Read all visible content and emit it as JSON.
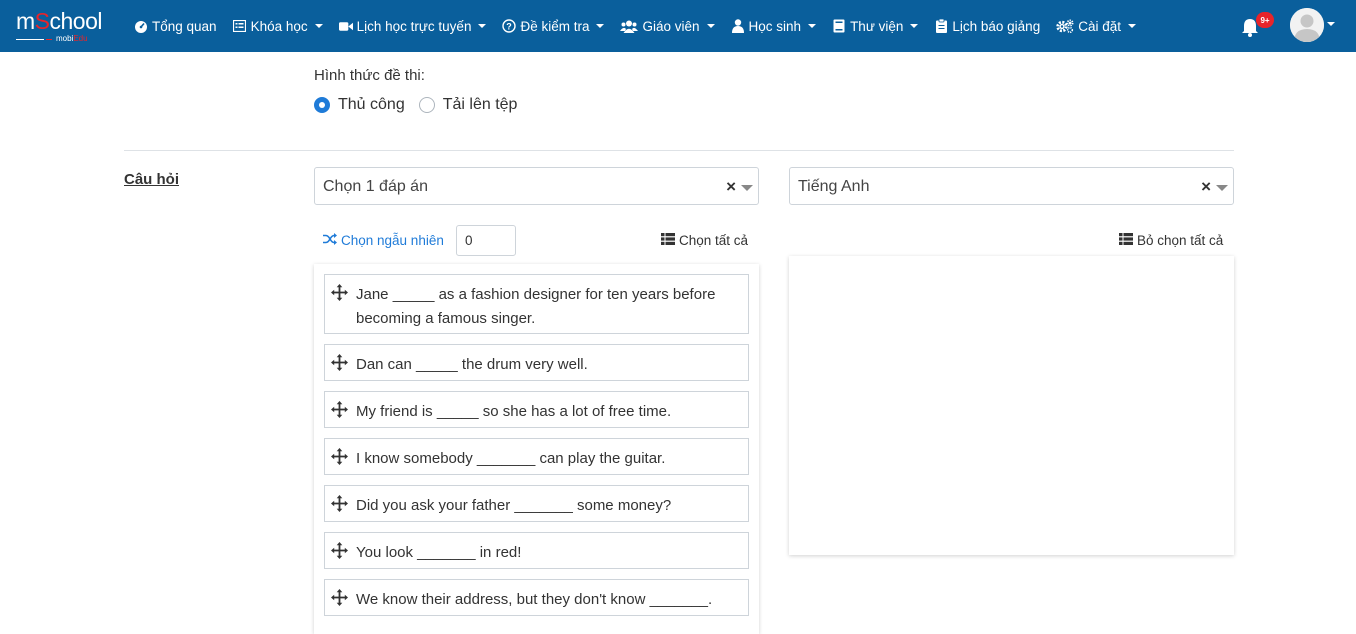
{
  "brand": {
    "logo_main": "m",
    "logo_o": "S",
    "logo_rest": "chool",
    "logo_sub_a": "mobi",
    "logo_sub_b": "Edu"
  },
  "nav": {
    "items": [
      {
        "label": "Tổng quan",
        "icon": "dashboard-icon",
        "dropdown": false
      },
      {
        "label": "Khóa học",
        "icon": "list-icon",
        "dropdown": true
      },
      {
        "label": "Lịch học trực tuyến",
        "icon": "video-icon",
        "dropdown": true
      },
      {
        "label": "Đề kiểm tra",
        "icon": "question-icon",
        "dropdown": true
      },
      {
        "label": "Giáo viên",
        "icon": "users-icon",
        "dropdown": true
      },
      {
        "label": "Học sinh",
        "icon": "user-icon",
        "dropdown": true
      },
      {
        "label": "Thư viện",
        "icon": "book-icon",
        "dropdown": true
      },
      {
        "label": "Lịch báo giảng",
        "icon": "clipboard-icon",
        "dropdown": false
      },
      {
        "label": "Cài đặt",
        "icon": "gears-icon",
        "dropdown": true
      }
    ],
    "notification_badge": "9+"
  },
  "form": {
    "exam_type_label": "Hình thức đề thi:",
    "options": [
      {
        "label": "Thủ công",
        "checked": true
      },
      {
        "label": "Tải lên tệp",
        "checked": false
      }
    ]
  },
  "questions": {
    "section_label": "Câu hỏi",
    "type_select": "Chọn 1 đáp án",
    "subject_select": "Tiếng Anh",
    "random_label": "Chọn ngẫu nhiên",
    "random_value": "0",
    "select_all_label": "Chọn tất cả",
    "deselect_all_label": "Bỏ chọn tất cả",
    "items": [
      "Jane _____ as a fashion designer for ten years before becoming a famous singer.",
      "Dan can _____ the drum very well.",
      "My friend is _____ so she has a lot of free time.",
      "I know somebody _______ can play the guitar.",
      "Did you ask your father _______ some money?",
      "You look _______ in red!",
      "We know their address, but they don't know _______."
    ]
  },
  "colors": {
    "navbar": "#0a5f9c",
    "accent": "#1f7bd8",
    "badge": "#e8242a"
  }
}
